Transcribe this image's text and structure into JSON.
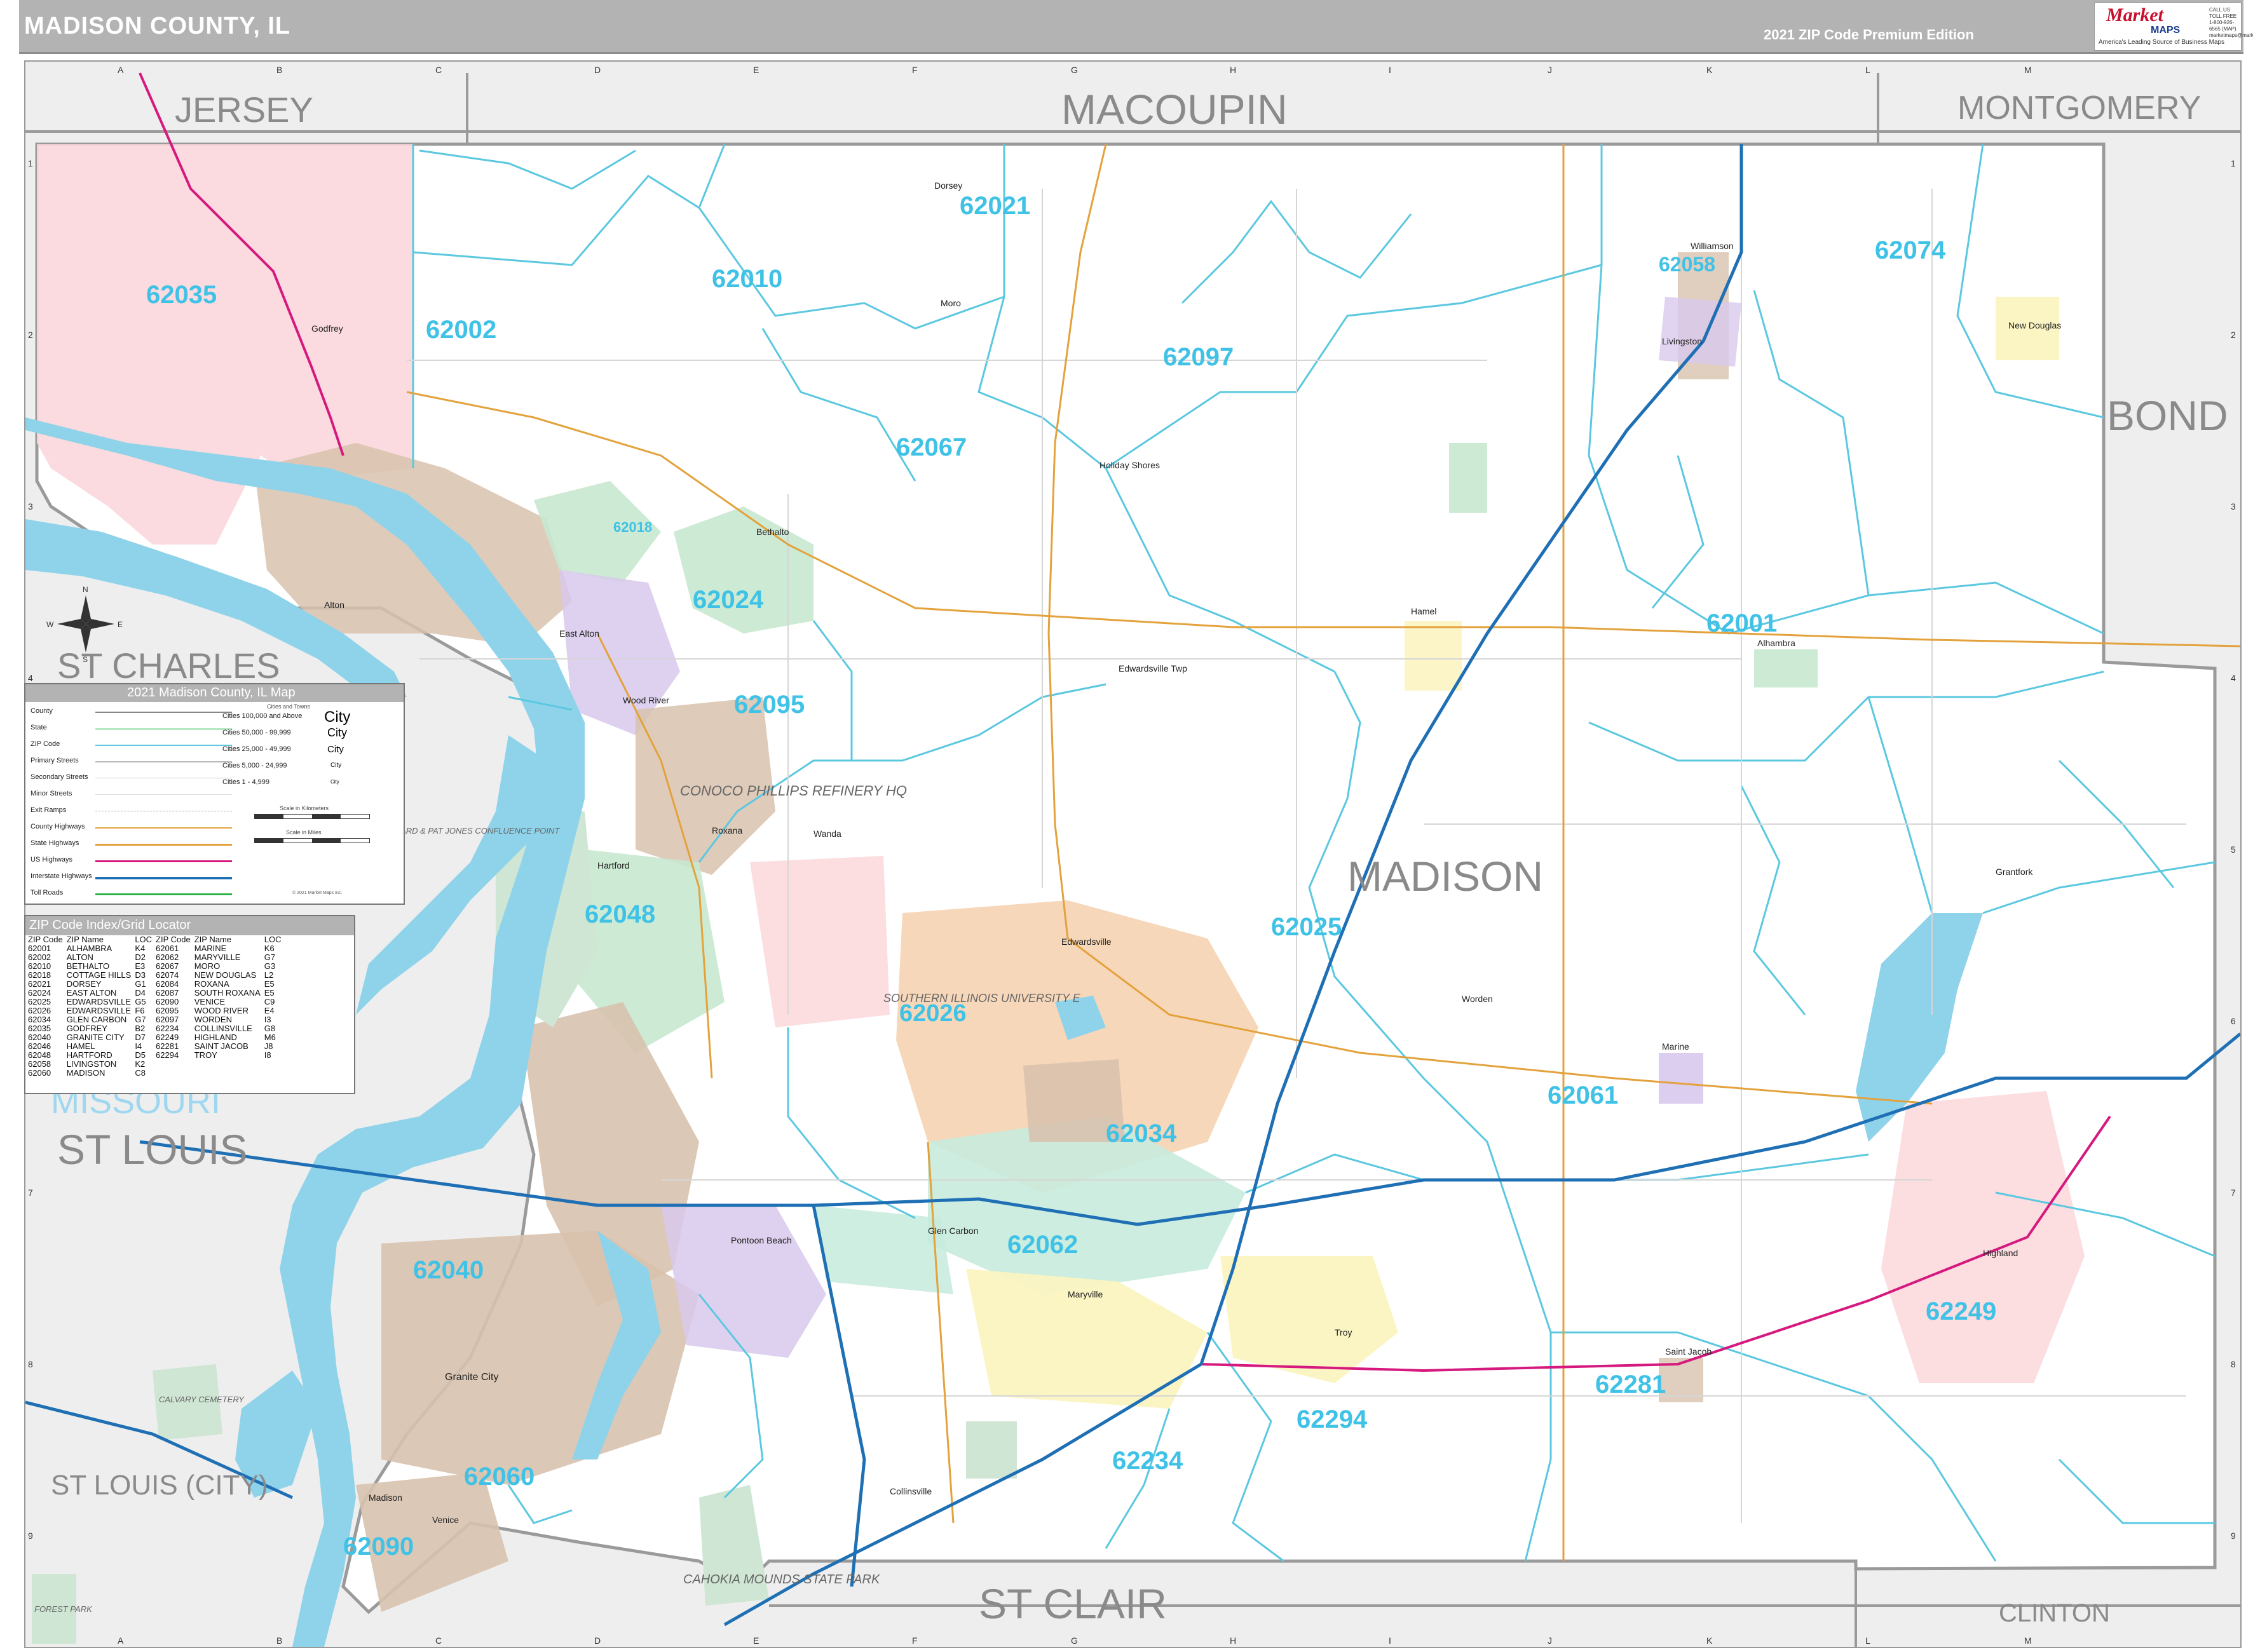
{
  "header": {
    "title": "MADISON COUNTY, IL",
    "edition": "2021 ZIP Code Premium Edition",
    "logo_word": "Market",
    "logo_maps": "MAPS",
    "logo_tagline": "America's Leading Source of Business Maps",
    "logo_motto": "On Target, On Time",
    "logo_contact": "CALL US TOLL FREE 1-800-926-6565 (MAP) marketmaps@marketmaps.com"
  },
  "grid": {
    "columns": [
      "A",
      "B",
      "C",
      "D",
      "E",
      "F",
      "G",
      "H",
      "I",
      "J",
      "K",
      "L",
      "M"
    ],
    "rows": [
      "1",
      "2",
      "3",
      "4",
      "5",
      "6",
      "7",
      "8",
      "9"
    ]
  },
  "counties": {
    "jersey": "JERSEY",
    "macoupin": "MACOUPIN",
    "montgomery": "MONTGOMERY",
    "bond": "BOND",
    "st_charles": "ST CHARLES",
    "madison": "MADISON",
    "st_louis": "ST LOUIS",
    "st_louis_city": "ST LOUIS (CITY)",
    "st_clair": "ST CLAIR",
    "clinton": "CLINTON",
    "missouri": "MISSOURI"
  },
  "zip_labels": [
    "62021",
    "62010",
    "62035",
    "62002",
    "62097",
    "62058",
    "62074",
    "62067",
    "62018",
    "62024",
    "62001",
    "62095",
    "62025",
    "62048",
    "62026",
    "62061",
    "62034",
    "62062",
    "62040",
    "62249",
    "62281",
    "62294",
    "62234",
    "62060",
    "62090"
  ],
  "cities": [
    "Alton",
    "Godfrey",
    "Granite City",
    "Edwardsville",
    "Collinsville",
    "Highland",
    "Troy",
    "Wood River",
    "Bethalto",
    "Roxana",
    "East Alton",
    "Maryville",
    "Glen Carbon",
    "Hartford",
    "Madison",
    "Venice",
    "Pontoon Beach",
    "Marine",
    "Worden",
    "Hamel",
    "Livingston",
    "New Douglas",
    "Alhambra",
    "Saint Jacob",
    "Moro",
    "Dorsey",
    "Williamson",
    "Grantfork",
    "Edwardsville Twp",
    "Holiday Shores",
    "Wanda"
  ],
  "landmarks": {
    "conoco": "CONOCO PHILLIPS REFINERY HQ",
    "siue": "SOUTHERN ILLINOIS UNIVERSITY E",
    "cahokia": "CAHOKIA MOUNDS STATE PARK",
    "confluence": "EDWARD & PAT JONES CONFLUENCE POINT",
    "calvary": "CALVARY CEMETERY",
    "forest_park": "FOREST PARK"
  },
  "compass": {
    "n": "N",
    "s": "S",
    "e": "E",
    "w": "W"
  },
  "legend": {
    "title": "2021 Madison County, IL Map",
    "rows": [
      "County",
      "State",
      "ZIP Code",
      "Primary Streets",
      "Secondary Streets",
      "Minor Streets",
      "Exit Ramps",
      "County Highways",
      "State Highways",
      "US Highways",
      "Interstate Highways",
      "Toll Roads"
    ],
    "city_header": "Cities and Towns",
    "city_rows": [
      {
        "label": "Cities 100,000 and Above",
        "sample": "City"
      },
      {
        "label": "Cities 50,000 - 99,999",
        "sample": "City"
      },
      {
        "label": "Cities 25,000 - 49,999",
        "sample": "City"
      },
      {
        "label": "Cities 5,000 - 24,999",
        "sample": "City"
      },
      {
        "label": "Cities 1 - 4,999",
        "sample": "City"
      }
    ],
    "scale_km": "Scale in Kilometers",
    "scale_mi": "Scale in Miles",
    "copyright": "© 2021 Market Maps Inc."
  },
  "zip_index": {
    "title": "ZIP Code Index/Grid Locator",
    "headers": [
      "ZIP Code",
      "ZIP Name",
      "LOC",
      "ZIP Code",
      "ZIP Name",
      "LOC"
    ],
    "rows": [
      [
        "62001",
        "ALHAMBRA",
        "K4",
        "62061",
        "MARINE",
        "K6"
      ],
      [
        "62002",
        "ALTON",
        "D2",
        "62062",
        "MARYVILLE",
        "G7"
      ],
      [
        "62010",
        "BETHALTO",
        "E3",
        "62067",
        "MORO",
        "G3"
      ],
      [
        "62018",
        "COTTAGE HILLS",
        "D3",
        "62074",
        "NEW DOUGLAS",
        "L2"
      ],
      [
        "62021",
        "DORSEY",
        "G1",
        "62084",
        "ROXANA",
        "E5"
      ],
      [
        "62024",
        "EAST ALTON",
        "D4",
        "62087",
        "SOUTH ROXANA",
        "E5"
      ],
      [
        "62025",
        "EDWARDSVILLE",
        "G5",
        "62090",
        "VENICE",
        "C9"
      ],
      [
        "62026",
        "EDWARDSVILLE",
        "F6",
        "62095",
        "WOOD RIVER",
        "E4"
      ],
      [
        "62034",
        "GLEN CARBON",
        "G7",
        "62097",
        "WORDEN",
        "I3"
      ],
      [
        "62035",
        "GODFREY",
        "B2",
        "62234",
        "COLLINSVILLE",
        "G8"
      ],
      [
        "62040",
        "GRANITE CITY",
        "D7",
        "62249",
        "HIGHLAND",
        "M6"
      ],
      [
        "62046",
        "HAMEL",
        "I4",
        "62281",
        "SAINT JACOB",
        "J8"
      ],
      [
        "62048",
        "HARTFORD",
        "D5",
        "62294",
        "TROY",
        "I8"
      ],
      [
        "62058",
        "LIVINGSTON",
        "K2",
        "",
        "",
        ""
      ],
      [
        "62060",
        "MADISON",
        "C8",
        "",
        "",
        ""
      ]
    ]
  },
  "colors": {
    "header_bg": "#b3b3b3",
    "river": "#8fd3ea",
    "county_shade": "#eeeeee",
    "zip_boundary": "#5bc8e0",
    "interstate": "#1f6fb5",
    "us_highway": "#d6197f",
    "state_highway": "#e3a23c",
    "zip_label": "#3fc2e6"
  }
}
